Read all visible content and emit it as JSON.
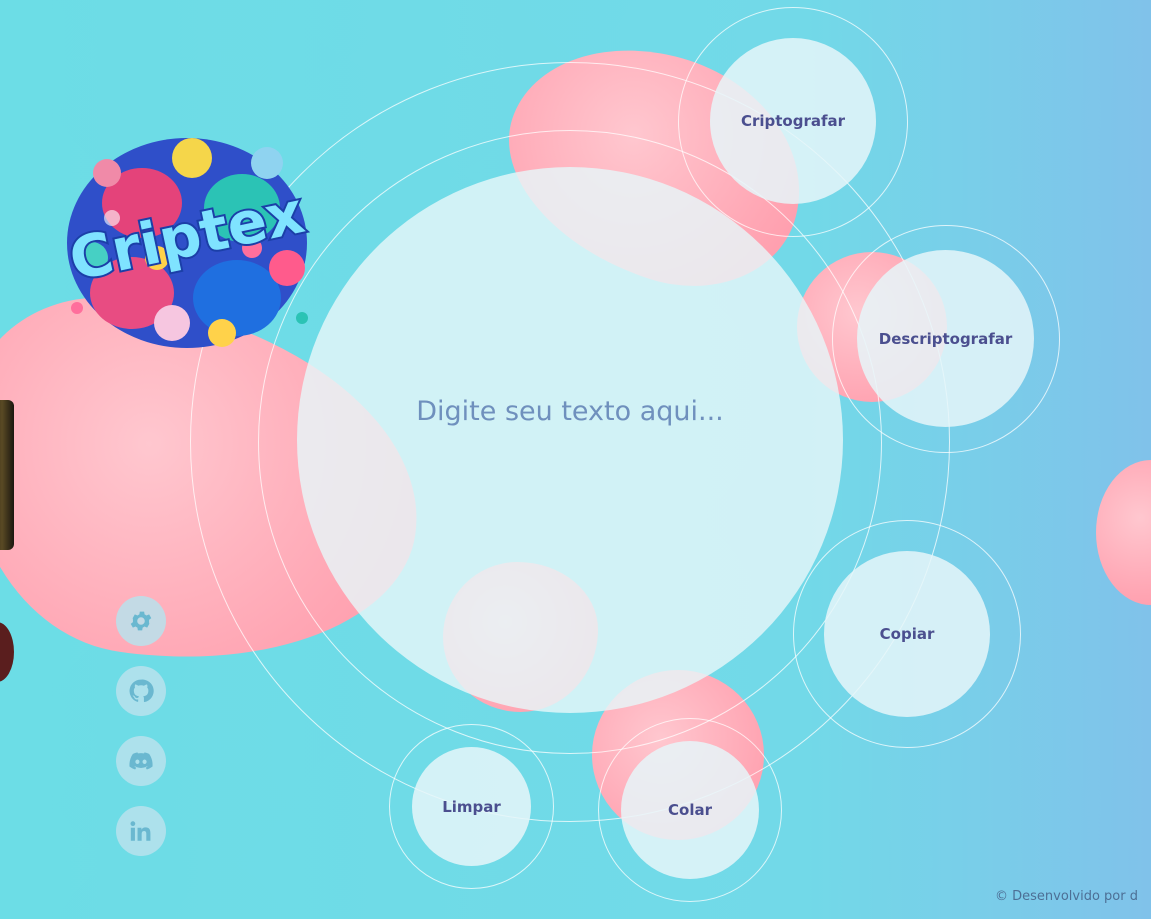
{
  "app": {
    "logo_text": "Criptex"
  },
  "editor": {
    "placeholder": "Digite seu texto aqui..."
  },
  "actions": {
    "encrypt_label": "Criptografar",
    "decrypt_label": "Descriptografar",
    "copy_label": "Copiar",
    "paste_label": "Colar",
    "clear_label": "Limpar"
  },
  "sidebar": {
    "icons": [
      "gear-icon",
      "github-icon",
      "discord-icon",
      "linkedin-icon"
    ]
  },
  "footer": {
    "text": "© Desenvolvido por d"
  },
  "colors": {
    "background": "#6cdde6",
    "blob": "#ffa5b3",
    "button_text": "#4b4f8f",
    "placeholder_text": "#6f90bd",
    "icon": "#6ab8d0"
  }
}
